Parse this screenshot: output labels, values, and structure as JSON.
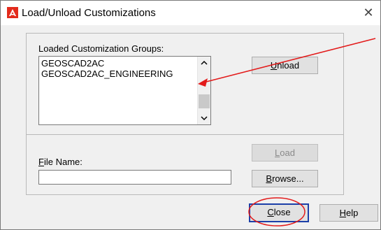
{
  "window": {
    "title": "Load/Unload Customizations",
    "close_glyph": "✕",
    "app_icon": "autocad-a-icon"
  },
  "groups": {
    "label": "Loaded Customization Groups:",
    "label_mnemonic": "G",
    "items": [
      "GEOSCAD2AC",
      "GEOSCAD2AC_ENGINEERING"
    ]
  },
  "buttons": {
    "unload": "Unload",
    "load": "Load",
    "browse": "Browse...",
    "close": "Close",
    "help": "Help"
  },
  "file": {
    "label": "File Name:",
    "value": ""
  },
  "scrollbar": {
    "up_glyph": "⌃",
    "down_glyph": "⌄"
  },
  "annotations": {
    "arrow_color": "#e31b1b",
    "ellipse_color": "#e31b1b",
    "default_button_border": "#1c3fa8"
  }
}
